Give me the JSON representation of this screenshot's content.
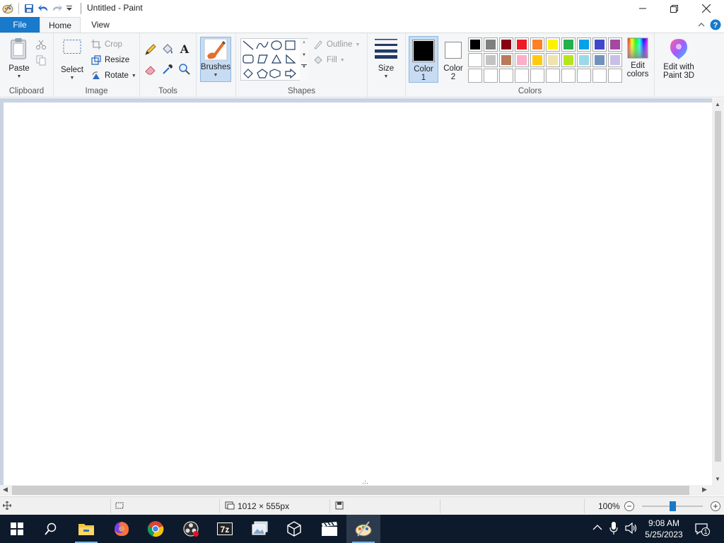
{
  "window": {
    "title": "Untitled - Paint"
  },
  "tabs": [
    {
      "label": "File"
    },
    {
      "label": "Home"
    },
    {
      "label": "View"
    }
  ],
  "ribbon": {
    "clipboard": {
      "group_label": "Clipboard",
      "paste_label": "Paste"
    },
    "image": {
      "group_label": "Image",
      "select_label": "Select",
      "crop_label": "Crop",
      "resize_label": "Resize",
      "rotate_label": "Rotate"
    },
    "tools": {
      "group_label": "Tools"
    },
    "brushes": {
      "label": "Brushes"
    },
    "shapes": {
      "group_label": "Shapes",
      "outline_label": "Outline",
      "fill_label": "Fill"
    },
    "size": {
      "label": "Size"
    },
    "colors": {
      "group_label": "Colors",
      "color1_label": "Color",
      "color1_num": "1",
      "color2_label": "Color",
      "color2_num": "2",
      "color1_value": "#000000",
      "color2_value": "#ffffff",
      "edit_colors_label_1": "Edit",
      "edit_colors_label_2": "colors",
      "palette_row1": [
        "#000000",
        "#7f7f7f",
        "#880015",
        "#ed1c24",
        "#ff7f27",
        "#fff200",
        "#22b14c",
        "#00a2e8",
        "#3f48cc",
        "#a349a4"
      ],
      "palette_row2": [
        "#ffffff",
        "#c3c3c3",
        "#b97a57",
        "#ffaec9",
        "#ffc90e",
        "#efe4b0",
        "#b5e61d",
        "#99d9ea",
        "#7092be",
        "#c8bfe7"
      ]
    },
    "paint3d": {
      "label_1": "Edit with",
      "label_2": "Paint 3D"
    }
  },
  "statusbar": {
    "canvas_size": "1012 × 555px",
    "zoom": "100%",
    "zoom_level": 0.5
  },
  "taskbar": {
    "time": "9:08 AM",
    "date": "5/25/2023",
    "notification_count": "1"
  },
  "accent": "#1979ca"
}
